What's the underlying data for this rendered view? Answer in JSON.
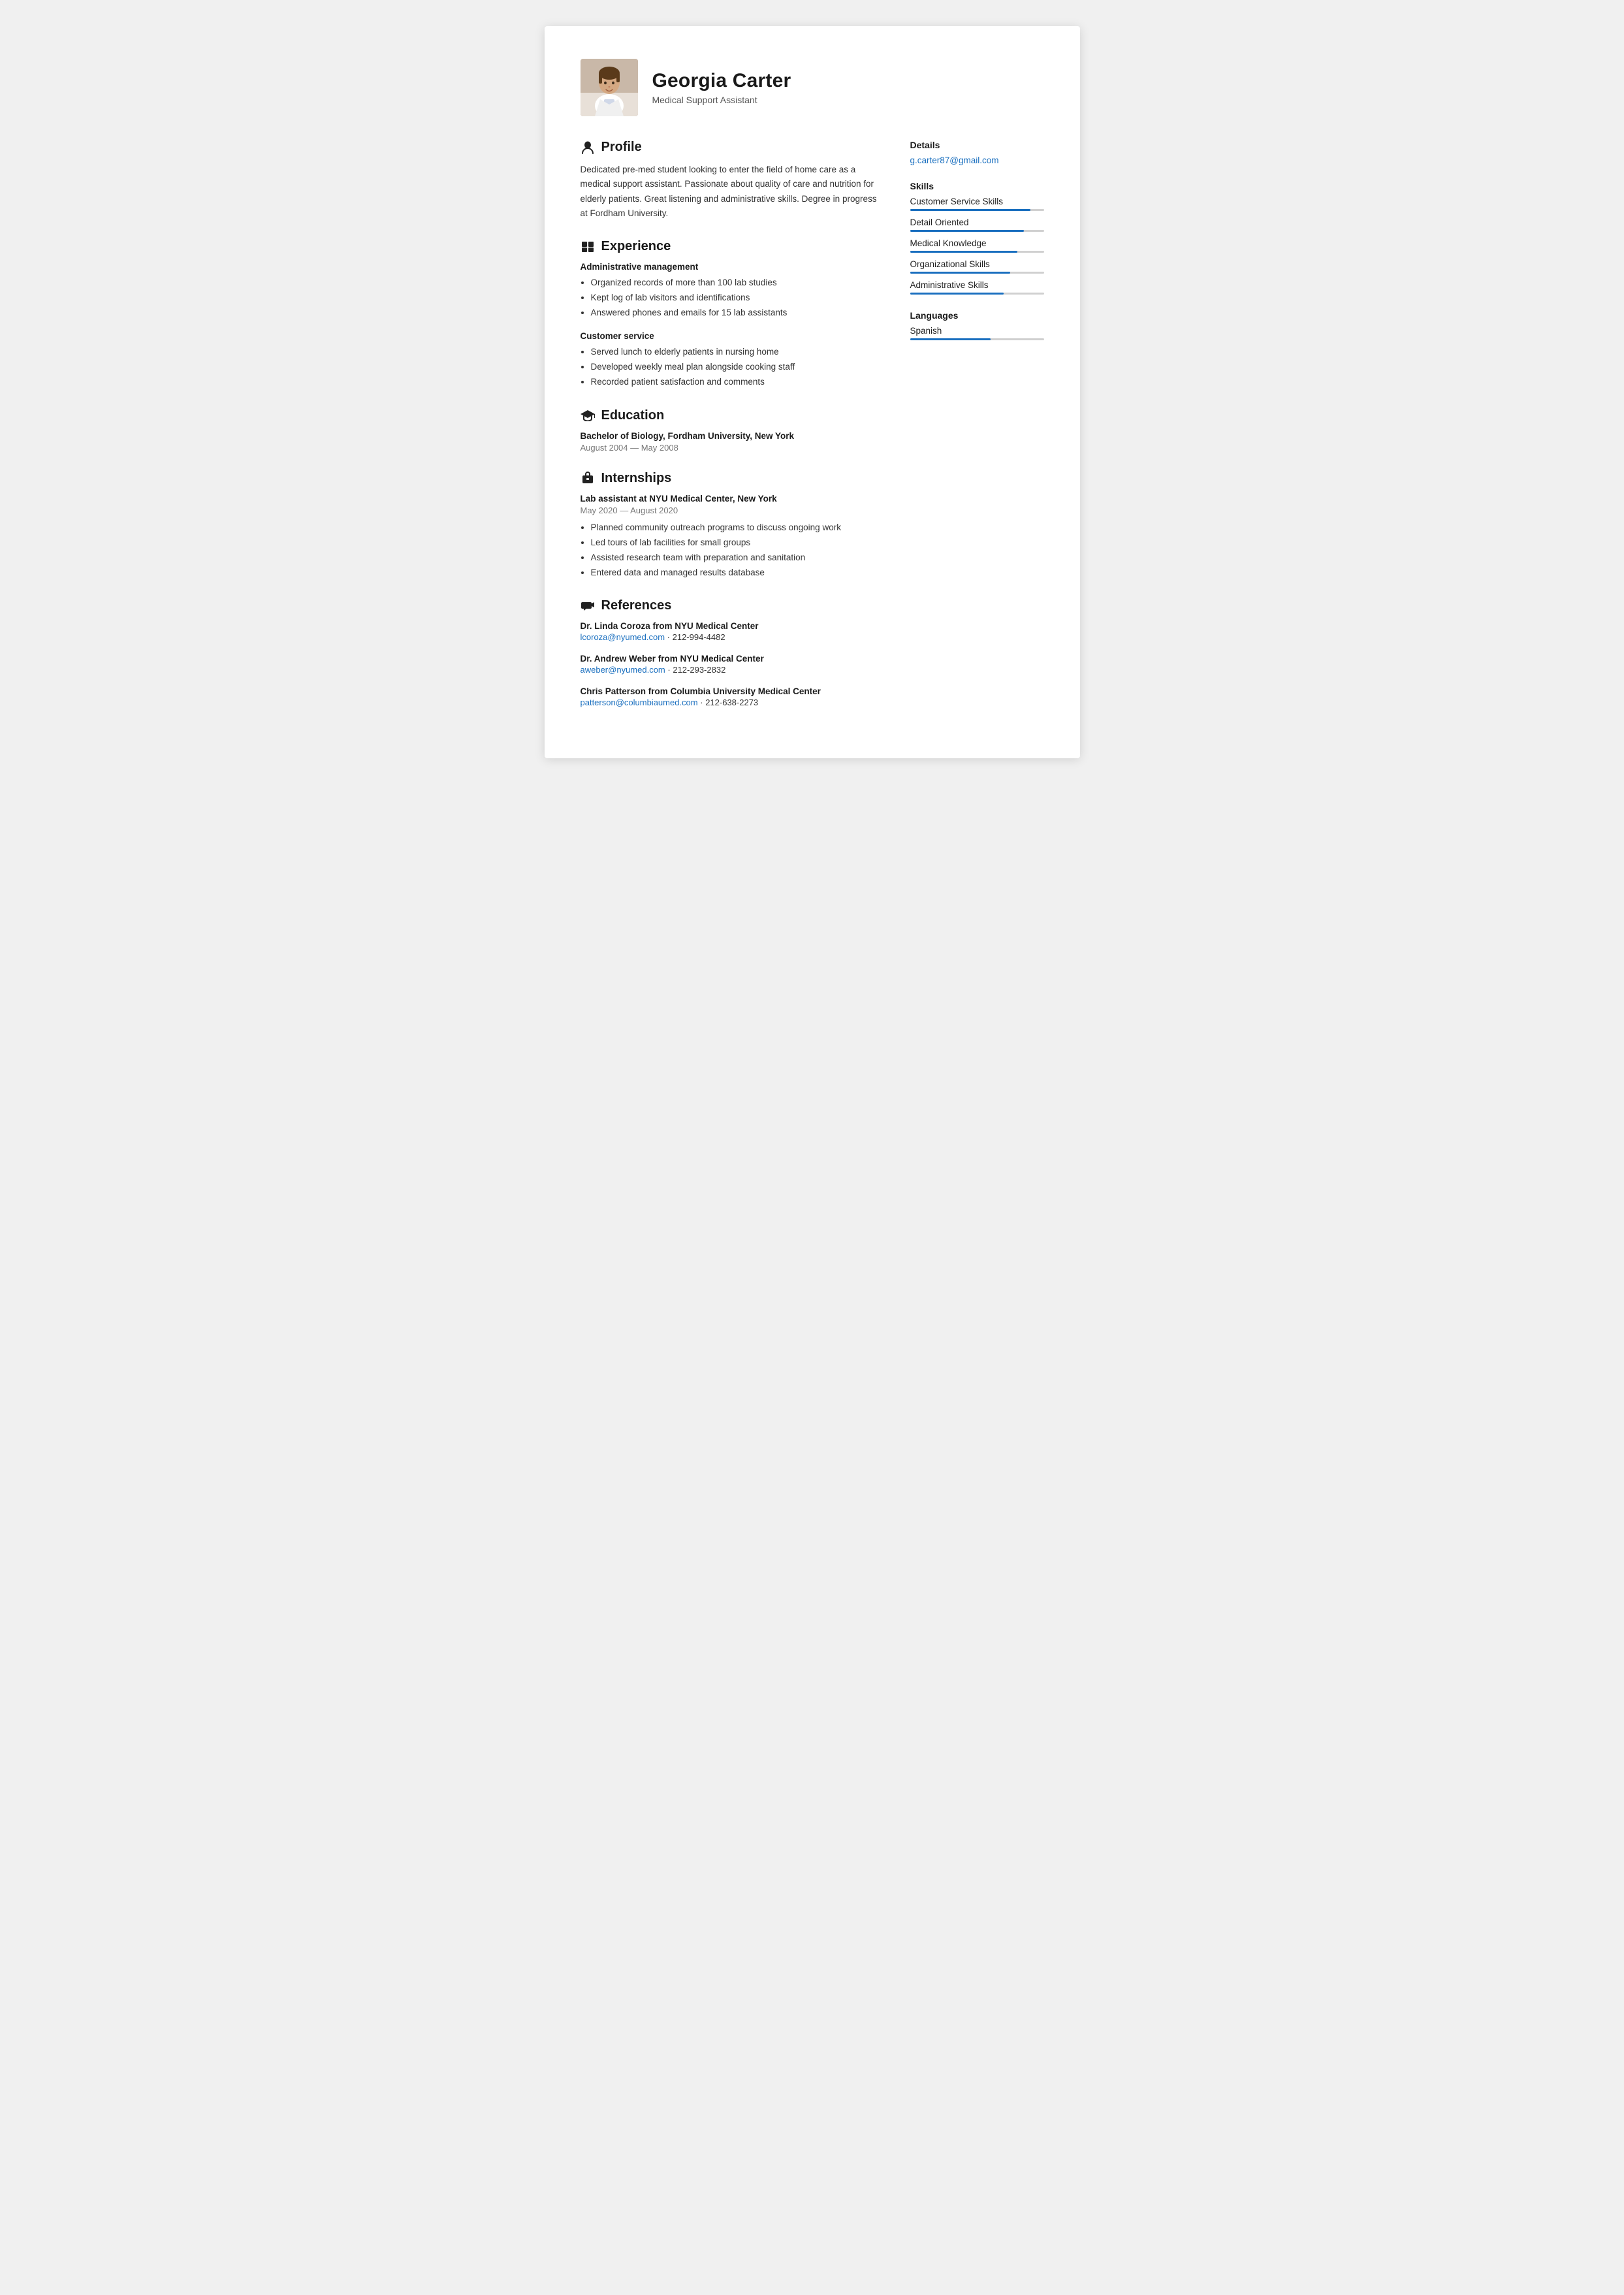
{
  "header": {
    "name": "Georgia Carter",
    "title": "Medical Support Assistant",
    "avatar_alt": "Georgia Carter photo"
  },
  "profile": {
    "section_title": "Profile",
    "text": "Dedicated pre-med student looking to enter the field of home care as a medical support assistant. Passionate about quality of care and nutrition for elderly patients. Great listening and administrative skills. Degree in progress at Fordham University."
  },
  "experience": {
    "section_title": "Experience",
    "jobs": [
      {
        "title": "Administrative management",
        "bullets": [
          "Organized records of more than 100 lab studies",
          "Kept log of lab visitors and identifications",
          "Answered phones and emails for 15 lab assistants"
        ]
      },
      {
        "title": "Customer service",
        "bullets": [
          "Served lunch to elderly patients in nursing home",
          "Developed weekly meal plan alongside cooking staff",
          "Recorded patient satisfaction and comments"
        ]
      }
    ]
  },
  "education": {
    "section_title": "Education",
    "degree": "Bachelor of Biology, Fordham University, New York",
    "dates": "August 2004 — May 2008"
  },
  "internships": {
    "section_title": "Internships",
    "items": [
      {
        "title": "Lab assistant at NYU Medical Center, New York",
        "dates": "May 2020 — August 2020",
        "bullets": [
          "Planned community outreach programs to discuss ongoing work",
          "Led tours of lab facilities for small groups",
          "Assisted research team with preparation and sanitation",
          "Entered data and managed results database"
        ]
      }
    ]
  },
  "references": {
    "section_title": "References",
    "items": [
      {
        "name": "Dr. Linda Coroza from NYU Medical Center",
        "email": "lcoroza@nyumed.com",
        "phone": "212-994-4482"
      },
      {
        "name": "Dr. Andrew Weber from NYU Medical Center",
        "email": "aweber@nyumed.com",
        "phone": "212-293-2832"
      },
      {
        "name": "Chris Patterson from Columbia University Medical Center",
        "email": "patterson@columbiaumed.com",
        "phone": "212-638-2273"
      }
    ]
  },
  "details": {
    "section_title": "Details",
    "email": "g.carter87@gmail.com"
  },
  "skills": {
    "section_title": "Skills",
    "items": [
      {
        "name": "Customer Service Skills",
        "percent": 90
      },
      {
        "name": "Detail Oriented",
        "percent": 85
      },
      {
        "name": "Medical Knowledge",
        "percent": 80
      },
      {
        "name": "Organizational Skills",
        "percent": 75
      },
      {
        "name": "Administrative Skills",
        "percent": 70
      }
    ]
  },
  "languages": {
    "section_title": "Languages",
    "items": [
      {
        "name": "Spanish",
        "percent": 60
      }
    ]
  },
  "icons": {
    "profile": "👤",
    "experience": "▦",
    "education": "🎓",
    "internships": "💼",
    "references": "📣"
  }
}
